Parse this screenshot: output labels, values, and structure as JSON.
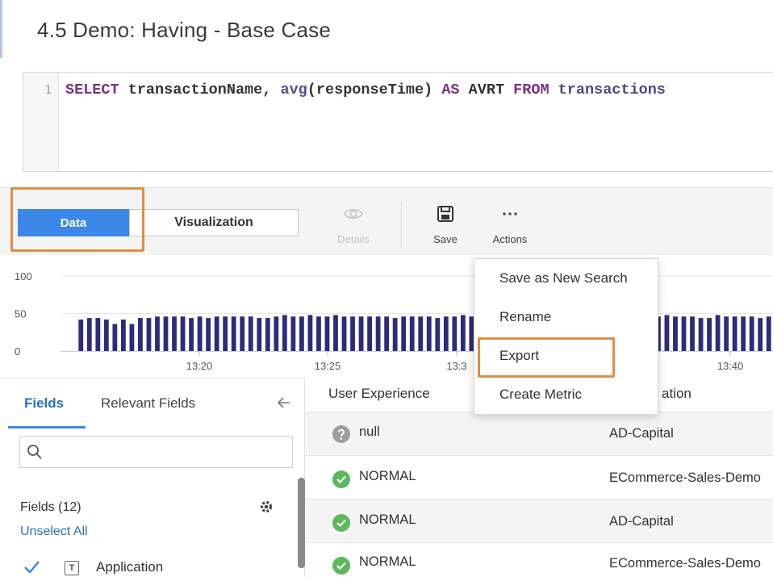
{
  "page": {
    "title": "4.5 Demo: Having - Base Case"
  },
  "editor": {
    "line_number": "1",
    "tokens": {
      "select": "SELECT",
      "field": " transactionName, ",
      "func": "avg",
      "func_arg": "(responseTime) ",
      "as": "AS",
      "alias": " AVRT ",
      "from": "FROM",
      "table": " transactions"
    }
  },
  "view_tabs": {
    "data": "Data",
    "visualization": "Visualization"
  },
  "toolbar": {
    "details": "Details",
    "save": "Save",
    "actions": "Actions"
  },
  "chart_data": {
    "type": "bar",
    "title": "",
    "y_ticks": [
      "100",
      "50",
      "0"
    ],
    "x_tick_labels": [
      "13:20",
      "13:25",
      "13:3",
      "13:40"
    ],
    "ylim": [
      0,
      100
    ],
    "grid": true,
    "color": "#2e2b7a",
    "values": [
      42,
      44,
      44,
      42,
      36,
      42,
      36,
      44,
      44,
      46,
      46,
      46,
      46,
      44,
      46,
      44,
      46,
      46,
      46,
      46,
      46,
      44,
      44,
      46,
      48,
      46,
      46,
      48,
      46,
      46,
      48,
      46,
      46,
      46,
      46,
      46,
      46,
      44,
      46,
      46,
      46,
      46,
      44,
      46,
      46,
      48,
      46,
      46,
      44,
      48,
      46,
      46,
      46,
      46,
      46,
      46,
      44,
      44,
      46,
      46,
      46,
      46,
      46,
      46,
      46,
      46,
      48,
      46,
      46,
      48,
      46,
      46,
      46,
      44,
      44,
      48,
      46,
      46,
      46,
      46,
      44,
      46
    ]
  },
  "actions_menu": {
    "items": [
      "Save as New Search",
      "Rename",
      "Export",
      "Create Metric"
    ]
  },
  "fields_panel": {
    "tab_fields": "Fields",
    "tab_relevant": "Relevant Fields",
    "search_placeholder": "",
    "fields_count": "Fields (12)",
    "unselect_all": "Unselect All",
    "field_type": "T",
    "first_field": "Application"
  },
  "table": {
    "headers": {
      "user_experience": "User Experience",
      "application": "ation"
    },
    "rows": [
      {
        "status": "unknown",
        "ux": "null",
        "app": "AD-Capital"
      },
      {
        "status": "normal",
        "ux": "NORMAL",
        "app": "ECommerce-Sales-Demo"
      },
      {
        "status": "normal",
        "ux": "NORMAL",
        "app": "AD-Capital"
      },
      {
        "status": "normal",
        "ux": "NORMAL",
        "app": "ECommerce-Sales-Demo"
      }
    ]
  },
  "colors": {
    "accent_blue": "#3c87e8",
    "highlight_orange": "#e38c43",
    "status_green": "#5cb85c",
    "status_gray": "#9e9e9e",
    "bar_color": "#2e2b7a"
  }
}
